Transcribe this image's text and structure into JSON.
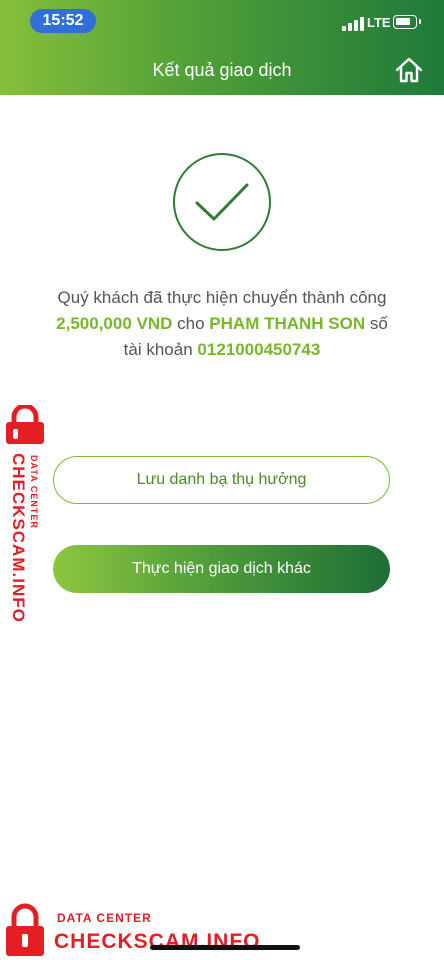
{
  "status_bar": {
    "time": "15:52",
    "network": "LTE"
  },
  "header": {
    "title": "Kết quả giao dịch",
    "home_icon": "home-icon"
  },
  "result": {
    "icon": "check-circle-icon",
    "line_prefix": "Quý khách đã thực hiện chuyển thành công",
    "amount": "2,500,000 VND",
    "to_word": "cho",
    "recipient": "PHAM THANH SON",
    "account_word": "số tài khoản",
    "account_number": "0121000450743"
  },
  "buttons": {
    "save_beneficiary": "Lưu danh bạ thụ hưởng",
    "new_transaction": "Thực hiện giao dịch khác"
  },
  "watermark": {
    "small_text": "DATA CENTER",
    "big_text": "CHECKSCAM.INFO"
  },
  "colors": {
    "brand_green_light": "#86bf3a",
    "brand_green_dark": "#1f7a3a",
    "highlight": "#76b82a",
    "watermark_red": "#e31e24",
    "time_pill": "#2f6fd8"
  }
}
